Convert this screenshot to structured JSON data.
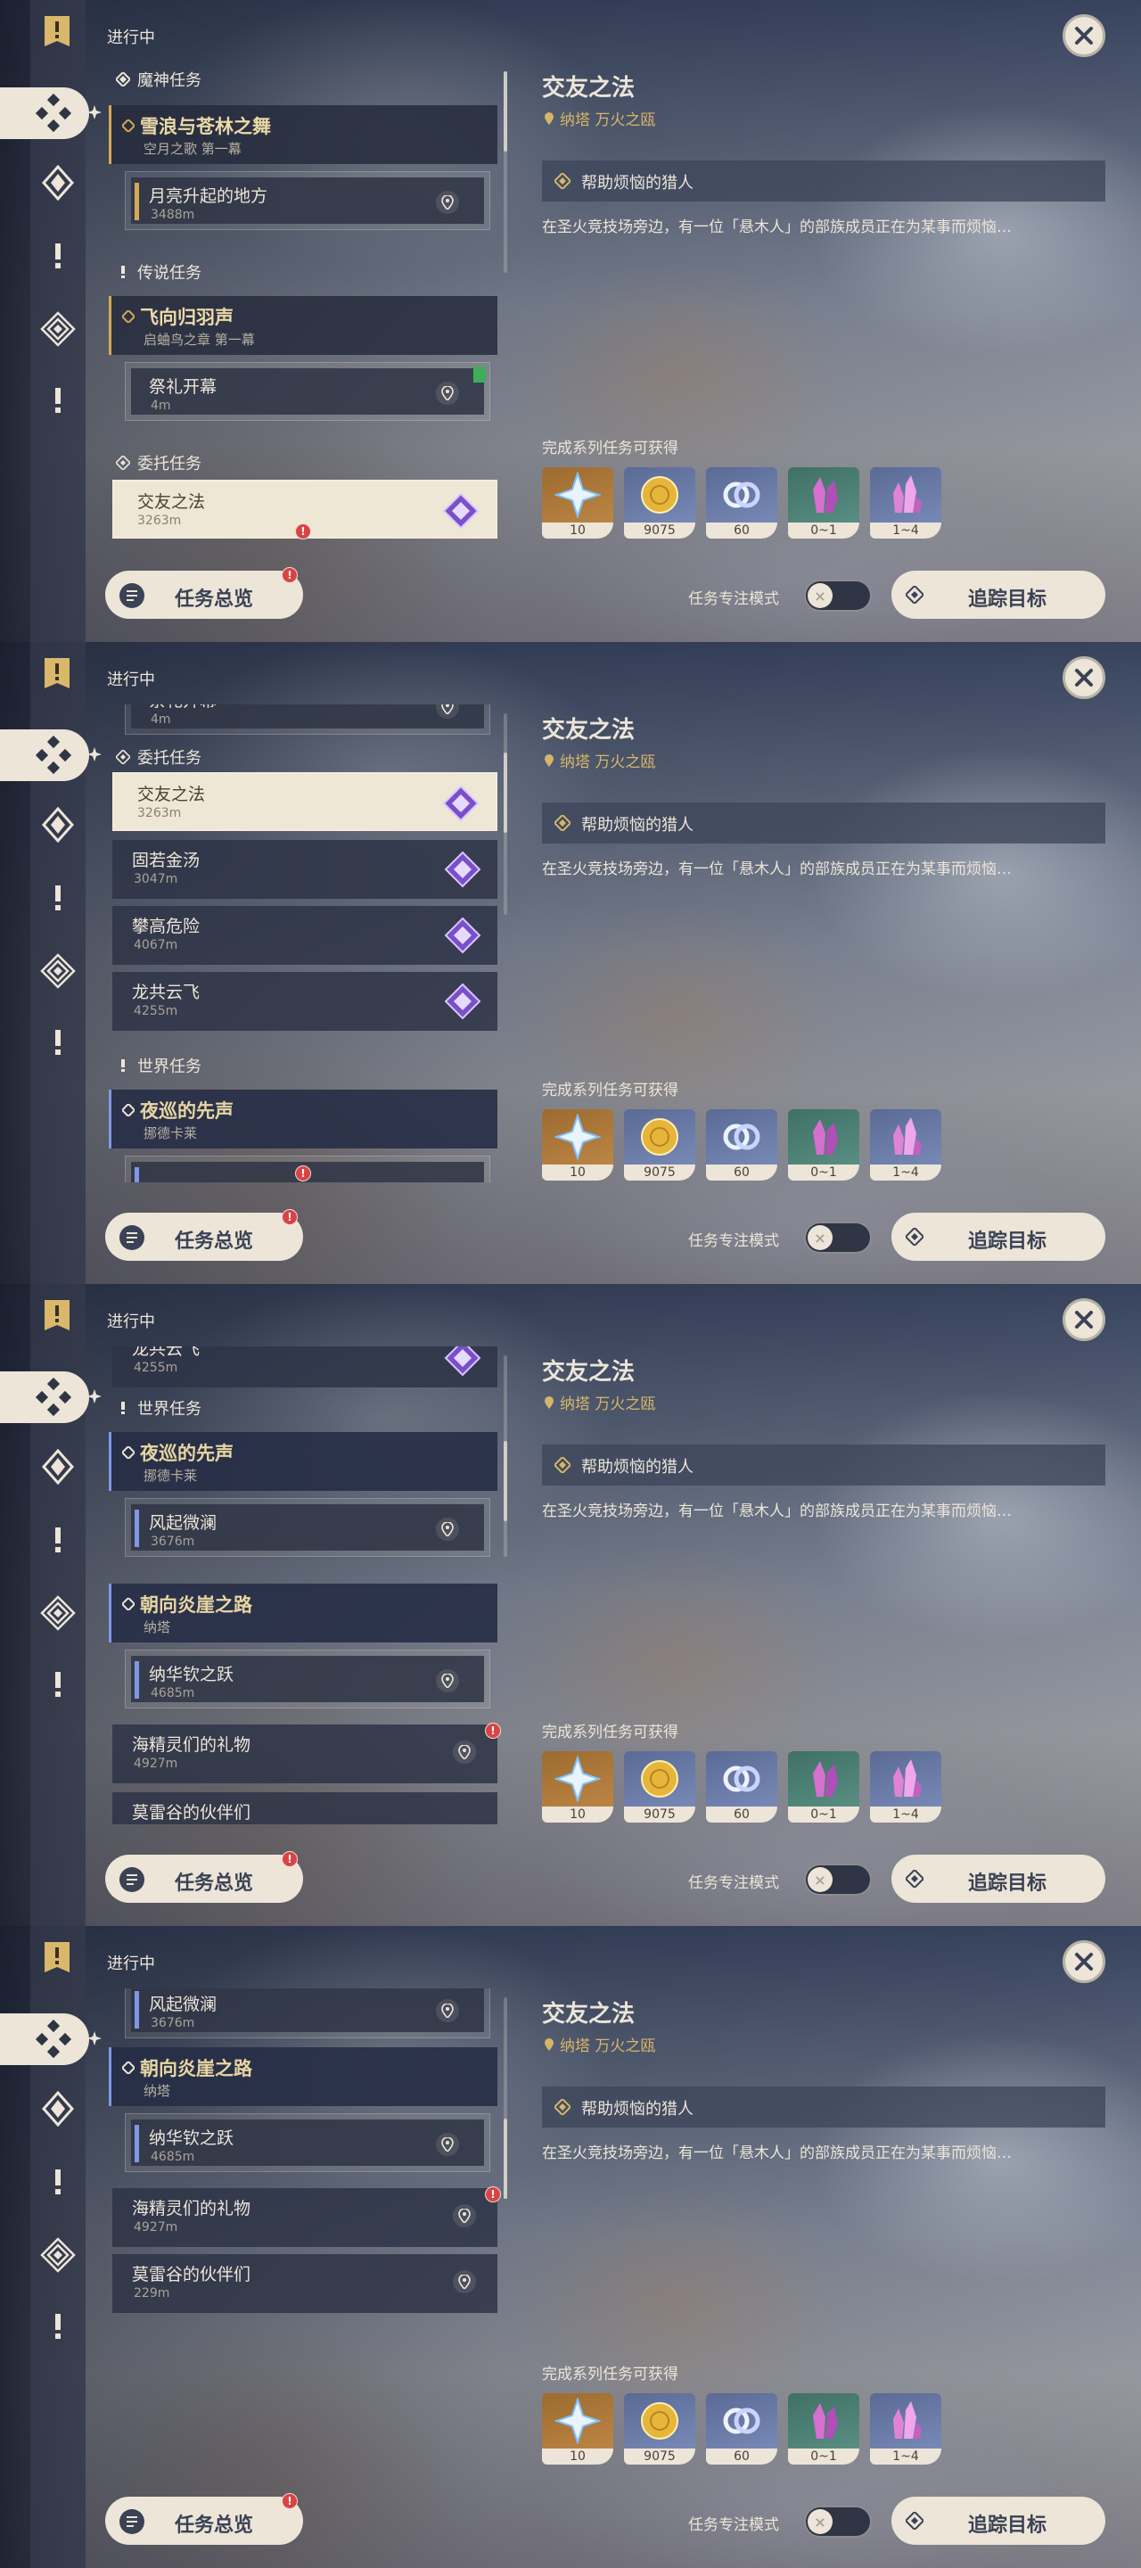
{
  "status_label": "进行中",
  "categories": {
    "archon": "魔神任务",
    "story": "传说任务",
    "commission": "委托任务",
    "world": "世界任务"
  },
  "quests": {
    "waves": {
      "title": "雪浪与苍林之舞",
      "sub": "空月之歌 第一幕"
    },
    "moon": {
      "title": "月亮升起的地方",
      "dist": "3488m"
    },
    "feather": {
      "title": "飞向归羽声",
      "sub": "启蛐鸟之章 第一幕"
    },
    "ritual": {
      "title": "祭礼开幕",
      "dist": "4m"
    },
    "friend": {
      "title": "交友之法",
      "dist": "3263m"
    },
    "soup": {
      "title": "固若金汤",
      "dist": "3047m"
    },
    "climb": {
      "title": "攀高危险",
      "dist": "4067m"
    },
    "dragon": {
      "title": "龙共云飞",
      "dist": "4255m"
    },
    "night": {
      "title": "夜巡的先声",
      "sub": "挪德卡莱"
    },
    "wind": {
      "title": "风起微澜",
      "dist": "3676m"
    },
    "cliff": {
      "title": "朝向炎崖之路",
      "sub": "纳塔"
    },
    "leap": {
      "title": "纳华钦之跃",
      "dist": "4685m"
    },
    "sea": {
      "title": "海精灵们的礼物",
      "dist": "4927m"
    },
    "valley": {
      "title": "莫雷谷的伙伴们",
      "dist": "229m"
    }
  },
  "detail": {
    "title": "交友之法",
    "location": "纳塔 万火之瓯",
    "step": "帮助烦恼的猎人",
    "description": "在圣火竞技场旁边，有一位「悬木人」的部族成员正在为某事而烦恼…",
    "rewards_label": "完成系列任务可获得",
    "rewards": [
      {
        "icon": "primogem-icon",
        "count": "10"
      },
      {
        "icon": "mora-icon",
        "count": "9075"
      },
      {
        "icon": "companionship-exp-icon",
        "count": "60"
      },
      {
        "icon": "crystal-ore-icon",
        "count": "0~1"
      },
      {
        "icon": "enhancement-crystal-icon",
        "count": "1~4"
      }
    ]
  },
  "buttons": {
    "overview": "任务总览",
    "focus_mode": "任务专注模式",
    "track": "追踪目标"
  },
  "colors": {
    "accent_gold": "#d6a953",
    "world_blue": "#7f97e6",
    "cream": "#ece5d8",
    "alert_red": "#d84444"
  }
}
